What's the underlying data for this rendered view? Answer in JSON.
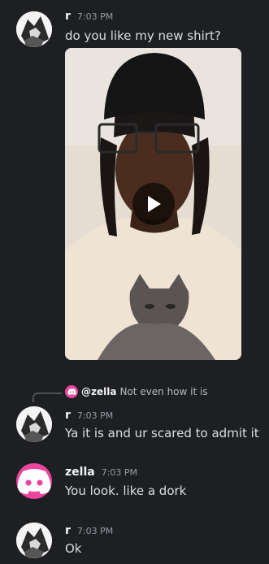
{
  "messages": [
    {
      "username": "r",
      "time": "7:03 PM",
      "text": "do you like my new shirt?",
      "avatar": "anime-avatar"
    },
    {
      "username": "r",
      "time": "7:03 PM",
      "text": "Ya it is and ur scared to admit it",
      "avatar": "anime-avatar",
      "reply": {
        "name": "@zella",
        "text": "Not even how it is"
      }
    },
    {
      "username": "zella",
      "time": "7:03 PM",
      "text": "You look. like a dork",
      "avatar": "discord-logo-icon"
    },
    {
      "username": "r",
      "time": "7:03 PM",
      "text": "Ok",
      "avatar": "anime-avatar"
    }
  ],
  "video": {
    "icon": "play-icon"
  },
  "colors": {
    "background": "#1e1f22",
    "discord_pink": "#eb459e",
    "muted": "#949ba4",
    "text": "#dbdee1"
  }
}
